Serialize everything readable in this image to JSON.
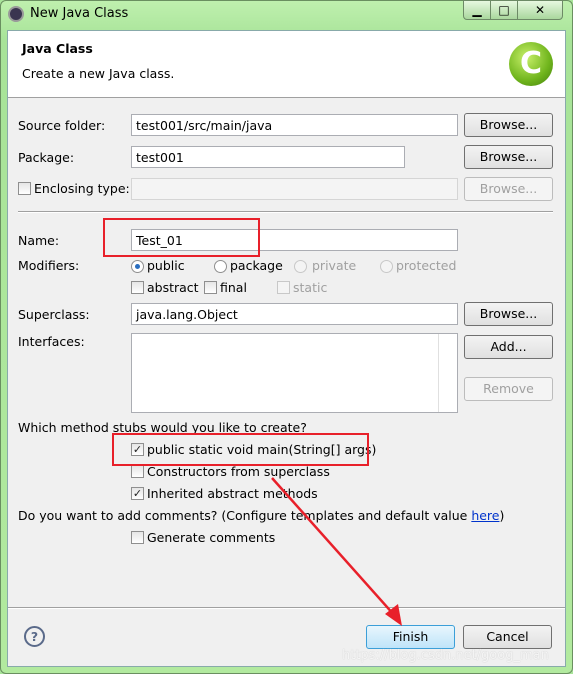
{
  "window": {
    "title": "New Java Class",
    "minimize": "▁",
    "maximize": "□",
    "close": "✕"
  },
  "header": {
    "title": "Java Class",
    "description": "Create a new Java class."
  },
  "form": {
    "source_folder": {
      "label": "Source folder:",
      "value": "test001/src/main/java",
      "browse": "Browse..."
    },
    "package": {
      "label": "Package:",
      "value": "test001",
      "browse": "Browse..."
    },
    "enclosing": {
      "label": "Enclosing type:",
      "value": "",
      "browse": "Browse...",
      "checked": false
    },
    "name": {
      "label": "Name:",
      "value": "Test_01"
    },
    "modifiers": {
      "label": "Modifiers:",
      "public": "public",
      "package": "package",
      "private": "private",
      "protected": "protected",
      "abstract": "abstract",
      "final": "final",
      "static": "static",
      "selected": "public"
    },
    "superclass": {
      "label": "Superclass:",
      "value": "java.lang.Object",
      "browse": "Browse..."
    },
    "interfaces": {
      "label": "Interfaces:",
      "add": "Add...",
      "remove": "Remove"
    },
    "stubs": {
      "question": "Which method stubs would you like to create?",
      "main": "public static void main(String[] args)",
      "constructors": "Constructors from superclass",
      "inherited": "Inherited abstract methods",
      "main_checked": true,
      "constructors_checked": false,
      "inherited_checked": true
    },
    "comments": {
      "question_pre": "Do you want to add comments? (Configure templates and default value ",
      "link": "here",
      "question_post": ")",
      "generate": "Generate comments",
      "checked": false
    }
  },
  "footer": {
    "help": "?",
    "finish": "Finish",
    "cancel": "Cancel"
  },
  "watermark": "https://blog.csdn.net/goog_man",
  "colors": {
    "highlight": "#e8202a",
    "accent": "#2a6ec0"
  }
}
